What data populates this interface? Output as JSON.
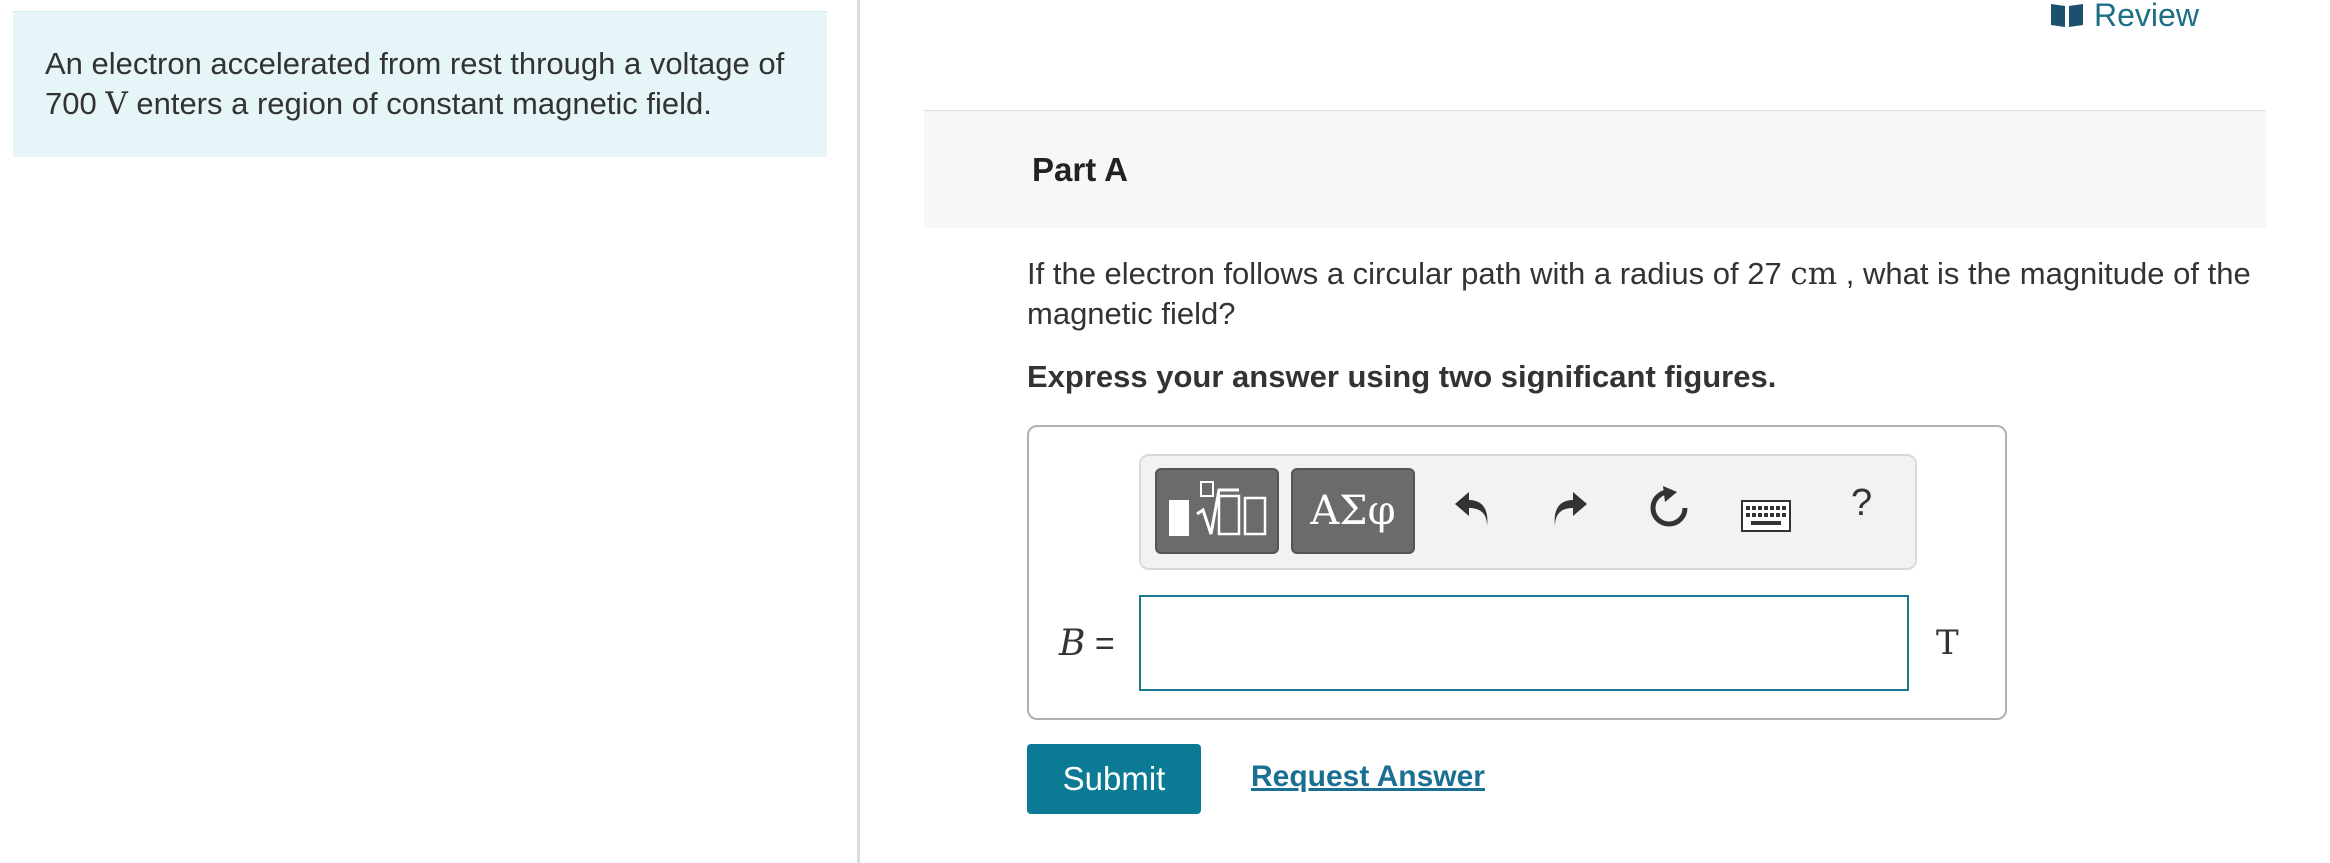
{
  "problem": {
    "text_before": "An electron accelerated from rest through a voltage of 700 ",
    "unit": "V",
    "text_after": " enters a region of constant magnetic field."
  },
  "review_link": {
    "label": "Review"
  },
  "part": {
    "title": "Part A"
  },
  "question": {
    "text_before": "If the electron follows a circular path with a radius of 27 ",
    "unit": "cm",
    "text_after": " , what is the magnitude of the magnetic field?"
  },
  "instruction": "Express your answer using two significant figures.",
  "toolbar": {
    "symbols_label": "ΑΣφ",
    "help_label": "?"
  },
  "answer": {
    "variable": "B",
    "equals": "=",
    "value": "",
    "unit": "T"
  },
  "actions": {
    "submit_label": "Submit",
    "request_label": "Request Answer"
  }
}
